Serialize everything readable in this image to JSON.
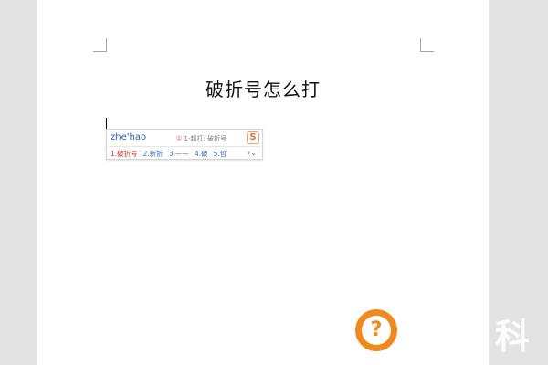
{
  "document": {
    "title": "破折号怎么打"
  },
  "ime": {
    "composition": "zhe'hao",
    "hint_number": "①",
    "hint_text": "1-超打: 破折号",
    "logo": "S",
    "more_label": "›⌄",
    "candidates": [
      {
        "label": "1.破折号"
      },
      {
        "label": "2.新折"
      },
      {
        "label": "3.——"
      },
      {
        "label": "4.破"
      },
      {
        "label": "5.哲"
      }
    ]
  },
  "help_button": {
    "label": "?"
  },
  "watermark": {
    "text": "科"
  },
  "colors": {
    "page_background": "#e3e3e3",
    "sheet": "#ffffff",
    "help_accent": "#f08a1e",
    "ime_accent": "#ee6b2b",
    "candidate_text": "#3a6fb8",
    "first_candidate": "#d23a2a"
  }
}
